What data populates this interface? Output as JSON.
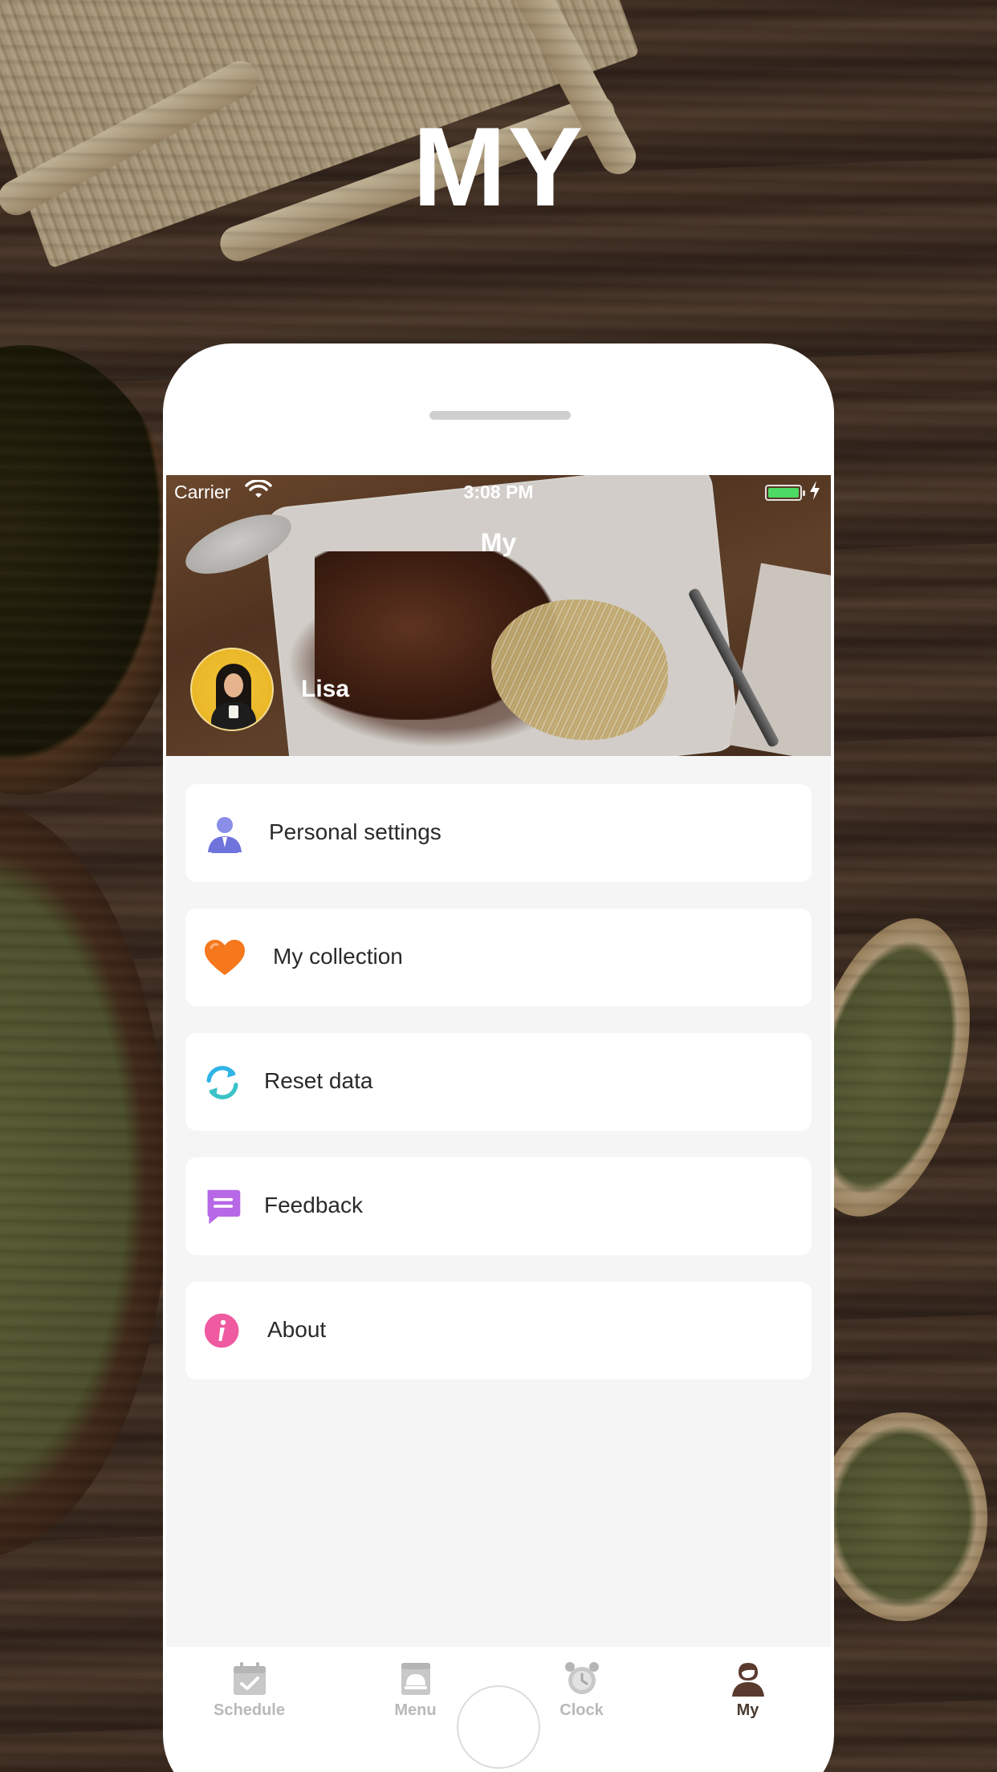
{
  "headline": "MY",
  "status_bar": {
    "carrier": "Carrier",
    "time": "3:08 PM"
  },
  "header": {
    "title": "My",
    "username": "Lisa"
  },
  "menu": [
    {
      "label": "Personal settings",
      "icon": "person-icon",
      "color": "#7b7fe0"
    },
    {
      "label": "My collection",
      "icon": "heart-icon",
      "color": "#f5781c"
    },
    {
      "label": "Reset data",
      "icon": "refresh-icon",
      "color": "#2fb4e6"
    },
    {
      "label": "Feedback",
      "icon": "message-icon",
      "color": "#b668e6"
    },
    {
      "label": "About",
      "icon": "info-icon",
      "color": "#ef5aa0"
    }
  ],
  "tabs": [
    {
      "label": "Schedule",
      "icon": "calendar-check-icon",
      "active": false
    },
    {
      "label": "Menu",
      "icon": "cloche-icon",
      "active": false
    },
    {
      "label": "Clock",
      "icon": "alarm-clock-icon",
      "active": false
    },
    {
      "label": "My",
      "icon": "user-profile-icon",
      "active": true
    }
  ],
  "colors": {
    "tab_inactive": "#b9b9b9",
    "tab_active": "#4a3a30",
    "screen_background": "#f5f5f5"
  }
}
